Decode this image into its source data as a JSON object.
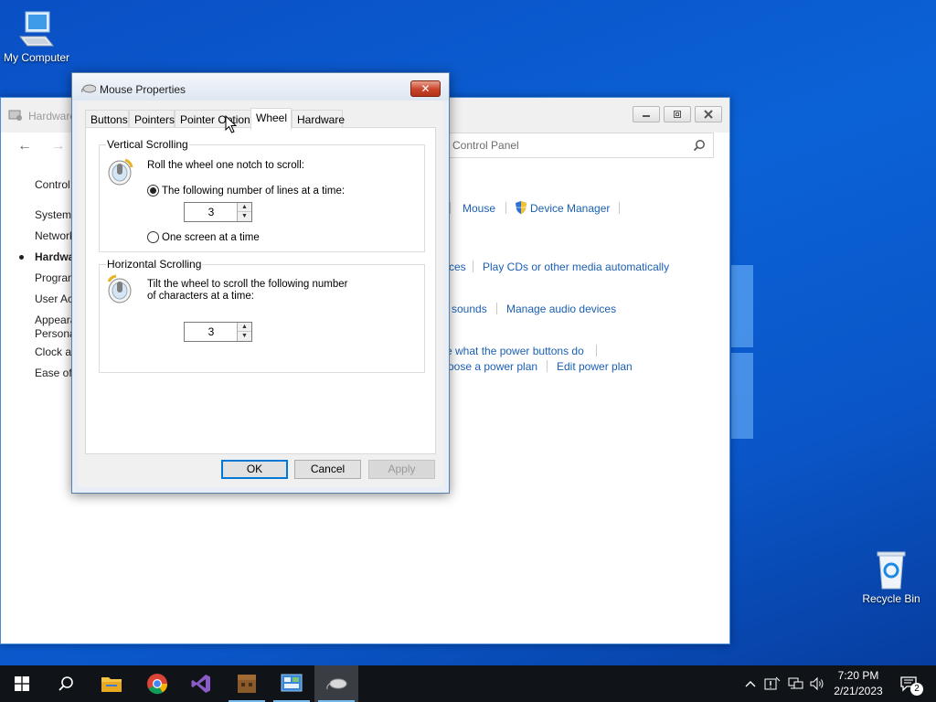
{
  "desktop": {
    "icons": {
      "my_computer": "My Computer",
      "recycle_bin": "Recycle Bin"
    }
  },
  "control_panel": {
    "title": "Hardware",
    "search_placeholder": "Control Panel",
    "nav": {
      "back": "←",
      "forward": "→"
    },
    "sidebar": [
      "Control",
      "System",
      "Network",
      "Hardwa",
      "Program",
      "User Ac",
      "Appeara",
      "Persona",
      "Clock a",
      "Ease of A"
    ],
    "links": {
      "mouse": "Mouse",
      "device_manager": "Device Manager",
      "autoplay_partial": "ces",
      "play_cds": "Play CDs or other media automatically",
      "sounds_partial": "sounds",
      "manage_audio": "Manage audio devices",
      "power_buttons_partial": "e what the power buttons do",
      "power_plan_partial": "oose a power plan",
      "edit_power_plan": "Edit power plan"
    }
  },
  "dialog": {
    "title": "Mouse Properties",
    "close": "✕",
    "tabs": [
      {
        "label": "Buttons"
      },
      {
        "label": "Pointers"
      },
      {
        "label": "Pointer Options"
      },
      {
        "label": "Wheel"
      },
      {
        "label": "Hardware"
      }
    ],
    "active_tab": "Wheel",
    "vertical": {
      "label": "Vertical Scrolling",
      "intro": "Roll the wheel one notch to scroll:",
      "option_lines": "The following number of lines at a time:",
      "option_lines_selected": true,
      "lines_value": "3",
      "option_screen": "One screen at a time",
      "option_screen_selected": false
    },
    "horizontal": {
      "label": "Horizontal Scrolling",
      "intro_line1": "Tilt the wheel to scroll the following number",
      "intro_line2": "of characters at a time:",
      "chars_value": "3"
    },
    "buttons": {
      "ok": "OK",
      "cancel": "Cancel",
      "apply": "Apply"
    }
  },
  "taskbar": {
    "clock": {
      "time": "7:20 PM",
      "date": "2/21/2023"
    },
    "notifications_count": "2"
  }
}
